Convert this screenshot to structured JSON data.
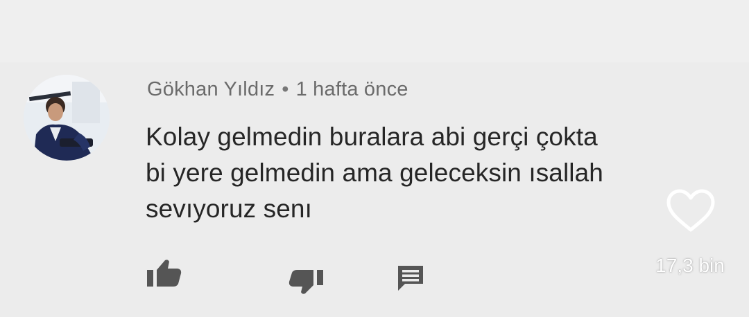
{
  "comment": {
    "author": "Gökhan Yıldız",
    "separator": "•",
    "time": "1 hafta önce",
    "lines": [
      "Kolay gelmedin buralara abi gerçi çokta",
      "bi yere gelmedin ama geleceksin ısallah",
      "sevıyoruz senı"
    ]
  },
  "actions": {
    "like_icon": "thumbs-up-icon",
    "dislike_icon": "thumbs-down-icon",
    "reply_icon": "comment-icon"
  },
  "overlay": {
    "heart_icon": "heart-outline-icon",
    "like_count": "17,3 bin"
  },
  "colors": {
    "background": "#ececec",
    "meta_text": "#6b6b6b",
    "body_text": "#262626",
    "icon_gray": "#555555",
    "overlay_white": "#ffffff"
  }
}
